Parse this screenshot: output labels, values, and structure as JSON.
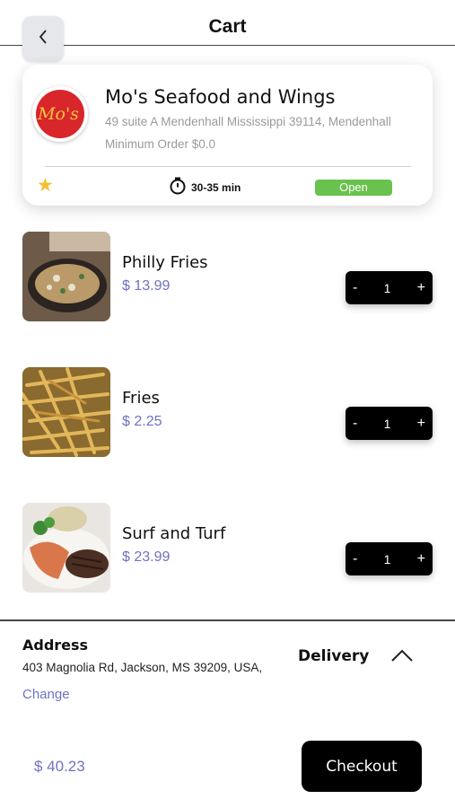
{
  "header": {
    "title": "Cart"
  },
  "restaurant": {
    "name": "Mo's Seafood and Wings",
    "address": "49 suite A Mendenhall Mississippi 39114, Mendenhall",
    "minimum_order": "Minimum Order $0.0",
    "delivery_time": "30-35 min",
    "status": "Open",
    "logo_text": "Mo's"
  },
  "items": [
    {
      "name": "Philly Fries",
      "price": "$ 13.99",
      "quantity": "1"
    },
    {
      "name": "Fries",
      "price": "$ 2.25",
      "quantity": "1"
    },
    {
      "name": "Surf and Turf",
      "price": "$ 23.99",
      "quantity": "1"
    }
  ],
  "stepper": {
    "minus": "-",
    "plus": "+"
  },
  "address": {
    "label": "Address",
    "value": "403 Magnolia Rd, Jackson, MS 39209, USA,",
    "change_label": "Change"
  },
  "delivery": {
    "label": "Delivery"
  },
  "footer": {
    "total": "$ 40.23",
    "checkout_label": "Checkout"
  },
  "colors": {
    "accent": "#6f72c2",
    "open": "#6ac24e",
    "star": "#f1c12e"
  },
  "icons": [
    "back-chevron-icon",
    "star-icon",
    "stopwatch-icon",
    "chevron-up-icon"
  ]
}
